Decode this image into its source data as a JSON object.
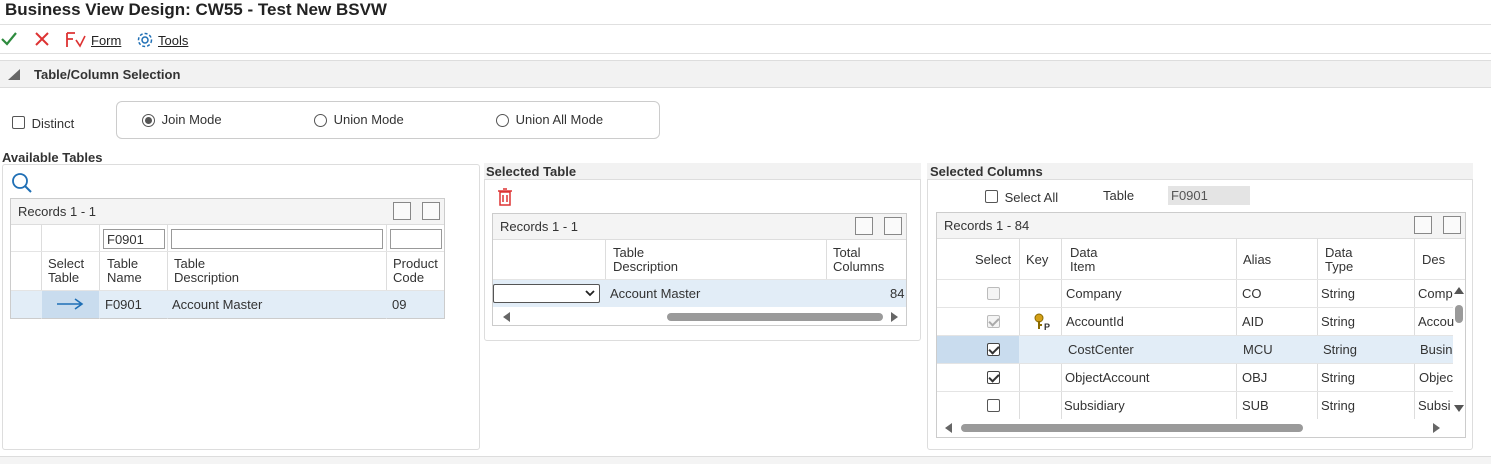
{
  "window": {
    "title": "Business View Design: CW55 - Test New BSVW"
  },
  "toolbar": {
    "ok_icon": "check-icon",
    "cancel_icon": "close-icon",
    "form_label": "Form",
    "tools_label": "Tools"
  },
  "section": {
    "title": "Table/Column Selection"
  },
  "options": {
    "distinct_label": "Distinct",
    "modes": [
      {
        "label": "Join Mode",
        "selected": true
      },
      {
        "label": "Union Mode",
        "selected": false
      },
      {
        "label": "Union All Mode",
        "selected": false
      }
    ]
  },
  "available_tables": {
    "title": "Available Tables",
    "records": "Records 1 - 1",
    "filter_value": "F0901",
    "columns": {
      "select_table": [
        "Select",
        "Table"
      ],
      "table_name": [
        "Table",
        "Name"
      ],
      "table_description": [
        "Table",
        "Description"
      ],
      "product_code": [
        "Product",
        "Code"
      ]
    },
    "rows": [
      {
        "table_name": "F0901",
        "description": "Account Master",
        "product_code": "09"
      }
    ]
  },
  "selected_table": {
    "title": "Selected Table",
    "records": "Records 1 - 1",
    "columns": {
      "table_description": [
        "Table",
        "Description"
      ],
      "total_columns": [
        "Total",
        "Columns"
      ]
    },
    "rows": [
      {
        "description": "Account Master",
        "total_columns": "84"
      }
    ]
  },
  "selected_columns": {
    "title": "Selected Columns",
    "select_all_label": "Select All",
    "table_label": "Table",
    "table_value": "F0901",
    "records": "Records 1 - 84",
    "columns": {
      "select": "Select",
      "key": "Key",
      "data_item": [
        "Data",
        "Item"
      ],
      "alias": "Alias",
      "data_type": [
        "Data",
        "Type"
      ],
      "description": "Des"
    },
    "rows": [
      {
        "selected": false,
        "disabled": true,
        "key": false,
        "data_item": "Company",
        "alias": "CO",
        "type": "String",
        "desc": "Comp"
      },
      {
        "selected": true,
        "disabled": true,
        "key": true,
        "data_item": "AccountId",
        "alias": "AID",
        "type": "String",
        "desc": "Accou"
      },
      {
        "selected": true,
        "disabled": false,
        "key": false,
        "data_item": "CostCenter",
        "alias": "MCU",
        "type": "String",
        "desc": "Busin"
      },
      {
        "selected": true,
        "disabled": false,
        "key": false,
        "data_item": "ObjectAccount",
        "alias": "OBJ",
        "type": "String",
        "desc": "Objec"
      },
      {
        "selected": false,
        "disabled": false,
        "key": false,
        "data_item": "Subsidiary",
        "alias": "SUB",
        "type": "String",
        "desc": "Subsi"
      }
    ]
  },
  "colors": {
    "accent": "#1f6fb5",
    "ok": "#2e8b3e",
    "cancel": "#d33",
    "selected_row": "#e2edf7"
  }
}
